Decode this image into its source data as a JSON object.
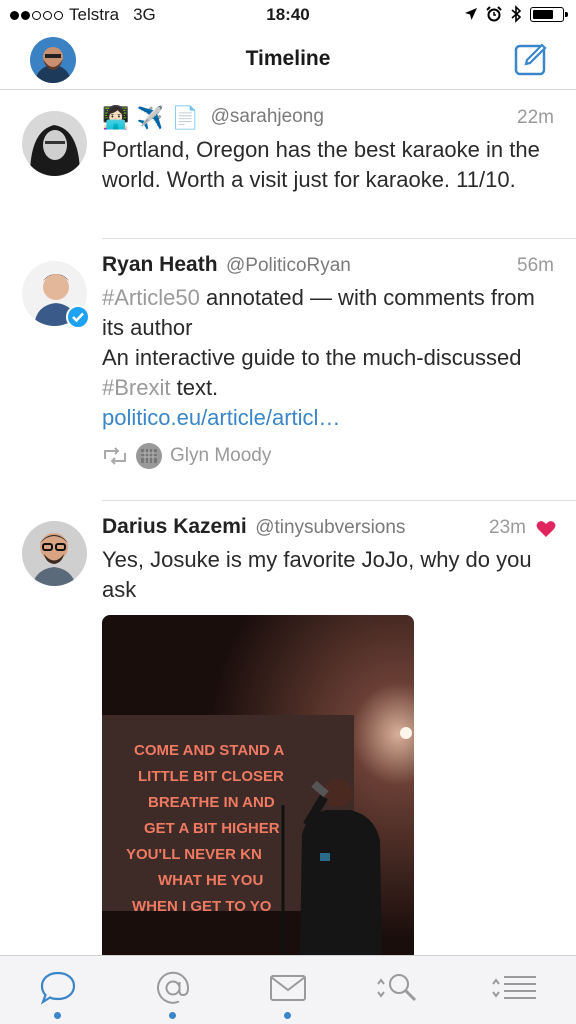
{
  "status_bar": {
    "carrier": "Telstra",
    "network": "3G",
    "time": "18:40",
    "signal_bars_filled": 2,
    "signal_bars_total": 5,
    "battery_level": 0.7,
    "icons": [
      "location-icon",
      "alarm-icon",
      "bluetooth-icon",
      "battery-icon"
    ]
  },
  "nav": {
    "title": "Timeline",
    "compose_icon": "compose-icon"
  },
  "tweets": [
    {
      "emojis": [
        "👩🏻‍💻",
        "✈️",
        "📄"
      ],
      "name": "",
      "handle": "@sarahjeong",
      "time": "22m",
      "text": "Portland, Oregon has the best karaoke in the world. Worth a visit just for karaoke. 11/10."
    },
    {
      "name": "Ryan Heath",
      "handle": "@PoliticoRyan",
      "time": "56m",
      "verified": true,
      "hashtag1": "#Article50",
      "text1": " annotated — with comments from its author",
      "text2": "An interactive guide to the much-discussed ",
      "hashtag2": "#Brexit",
      "text3": " text.",
      "link": "politico.eu/article/articl…",
      "retweeted_by": "Glyn Moody"
    },
    {
      "name": "Darius Kazemi",
      "handle": "@tinysubversions",
      "time": "23m",
      "liked": true,
      "text": "Yes, Josuke is my favorite JoJo, why do you ask",
      "media_lines": [
        "COME AND STAND A",
        "LITTLE BIT CLOSER",
        "BREATHE IN AND",
        "GET A BIT HIGHER",
        "YOU'LL NEVER KN",
        "WHAT HE YOU",
        "WHEN I GET TO YO"
      ]
    }
  ],
  "tab_bar": {
    "tabs": [
      {
        "icon": "chat-bubble-icon",
        "active": true,
        "dot": true
      },
      {
        "icon": "mentions-icon",
        "active": false,
        "dot": true
      },
      {
        "icon": "messages-icon",
        "active": false,
        "dot": true
      },
      {
        "icon": "search-icon",
        "active": false,
        "dot": false
      },
      {
        "icon": "lists-icon",
        "active": false,
        "dot": false
      }
    ]
  },
  "colors": {
    "accent": "#3a86c8",
    "like": "#e0245e",
    "verified": "#1da1f2"
  }
}
